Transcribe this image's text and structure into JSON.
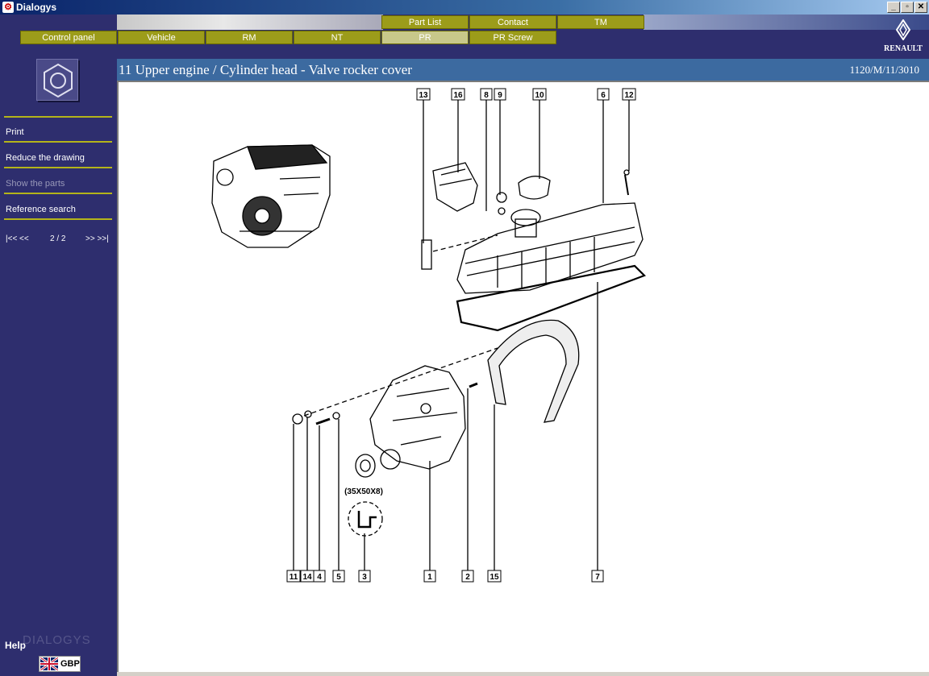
{
  "window": {
    "title": "Dialogys",
    "buttons": [
      "_",
      "▫",
      "✕"
    ]
  },
  "nav": {
    "row1": [
      "Part List",
      "Contact",
      "TM"
    ],
    "row2": [
      "Control panel",
      "Vehicle",
      "RM",
      "NT",
      "PR",
      "PR Screw"
    ],
    "active": "PR"
  },
  "brand": "RENAULT",
  "sidebar": {
    "items": [
      {
        "label": "Print",
        "enabled": true
      },
      {
        "label": "Reduce the drawing",
        "enabled": true
      },
      {
        "label": "Show the parts",
        "enabled": false
      },
      {
        "label": "Reference search",
        "enabled": true
      }
    ],
    "pager": {
      "first": "|<< <<",
      "page": "2 / 2",
      "last": ">> >>|"
    },
    "help": "Help",
    "watermark": "DIALOGYS",
    "currency": "GBP"
  },
  "header": {
    "title": "11 Upper engine / Cylinder head - Valve rocker cover",
    "reference": "1120/M/11/3010"
  },
  "diagram": {
    "callouts_top": [
      "13",
      "16",
      "8",
      "9",
      "10",
      "6",
      "12"
    ],
    "callouts_bottom": [
      "11",
      "14",
      "4",
      "5",
      "3",
      "1",
      "2",
      "15",
      "7"
    ],
    "seal_size": "(35X50X8)"
  },
  "colors": {
    "sidebar": "#2e2e6e",
    "nav_button": "#9c9c1a",
    "header": "#3c6aa0"
  }
}
